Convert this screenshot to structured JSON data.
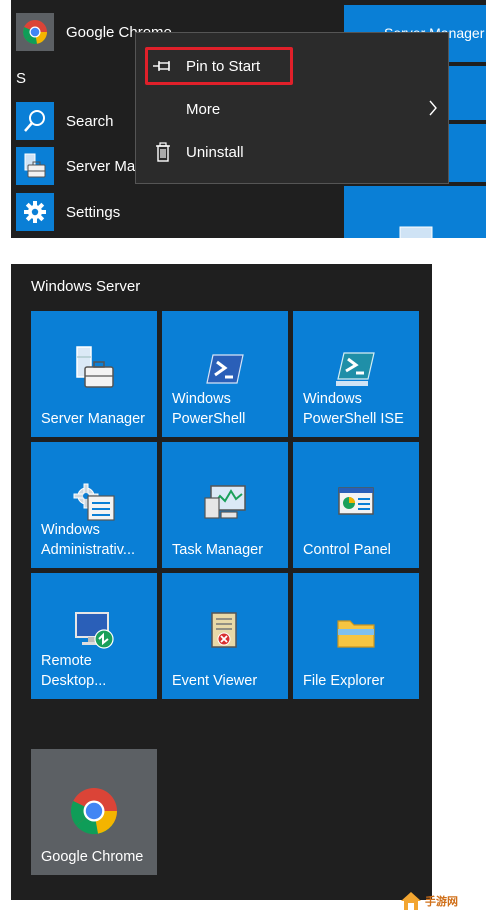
{
  "start_menu": {
    "section_letter": "S",
    "apps": [
      {
        "label": "Google Chrome",
        "icon": "chrome-icon"
      },
      {
        "label": "Search",
        "icon": "search-icon"
      },
      {
        "label": "Server Manager",
        "icon": "server-manager-icon"
      },
      {
        "label": "Settings",
        "icon": "gear-icon"
      }
    ],
    "live_tile_partial_text": "Server Manager"
  },
  "context_menu": {
    "items": [
      {
        "label": "Pin to Start",
        "icon": "pin-icon",
        "highlighted": true
      },
      {
        "label": "More",
        "icon": "chevron-right-icon"
      },
      {
        "label": "Uninstall",
        "icon": "trash-icon"
      }
    ]
  },
  "tile_group": {
    "title": "Windows Server",
    "tiles": [
      {
        "label": "Server Manager",
        "icon": "server-manager-icon"
      },
      {
        "label": "Windows\nPowerShell",
        "icon": "powershell-icon"
      },
      {
        "label": "Windows\nPowerShell ISE",
        "icon": "powershell-ise-icon"
      },
      {
        "label": "Windows\nAdministrativ...",
        "icon": "admin-tools-icon"
      },
      {
        "label": "Task Manager",
        "icon": "task-manager-icon"
      },
      {
        "label": "Control Panel",
        "icon": "control-panel-icon"
      },
      {
        "label": "Remote\nDesktop...",
        "icon": "remote-desktop-icon"
      },
      {
        "label": "Event Viewer",
        "icon": "event-viewer-icon"
      },
      {
        "label": "File Explorer",
        "icon": "folder-icon"
      }
    ],
    "pinned_tile": {
      "label": "Google Chrome",
      "icon": "chrome-icon"
    }
  },
  "watermark": {
    "text": "手游网"
  },
  "colors": {
    "tile_blue": "#0a7fd6",
    "panel_bg": "#1f1f1f",
    "menu_bg": "#2b2b2b",
    "highlight_red": "#e0202a",
    "pinned_tile_gray": "#5c6064"
  }
}
